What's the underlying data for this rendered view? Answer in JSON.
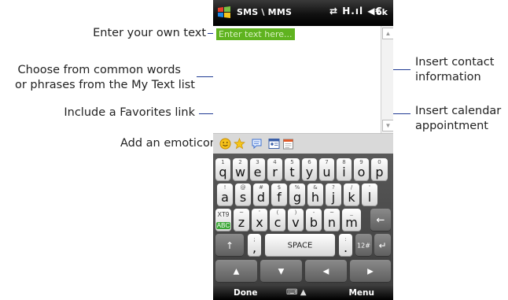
{
  "callouts": {
    "enter_text": "Enter your own text",
    "choose_words_line1": "Choose from common words",
    "choose_words_line2": "or phrases from the My Text list",
    "favorites_link": "Include a Favorites link",
    "emoticon": "Add an emoticon",
    "contact_line1": "Insert contact",
    "contact_line2": "information",
    "calendar_line1": "Insert calendar",
    "calendar_line2": "appointment"
  },
  "titlebar": {
    "title": "SMS \\ MMS",
    "status_icons": "⇄ H.ıl ◀€",
    "ok_label": "ok"
  },
  "message": {
    "placeholder": "Enter text here..."
  },
  "toolbar": {
    "icons": [
      "emoticon-icon",
      "favorites-star-icon",
      "my-text-icon",
      "contact-card-icon",
      "calendar-icon"
    ]
  },
  "keyboard": {
    "row1": [
      {
        "small": "1",
        "big": "q"
      },
      {
        "small": "2",
        "big": "w"
      },
      {
        "small": "3",
        "big": "e"
      },
      {
        "small": "4",
        "big": "r"
      },
      {
        "small": "5",
        "big": "t"
      },
      {
        "small": "6",
        "big": "y"
      },
      {
        "small": "7",
        "big": "u"
      },
      {
        "small": "8",
        "big": "i"
      },
      {
        "small": "9",
        "big": "o"
      },
      {
        "small": "0",
        "big": "p"
      }
    ],
    "row2": [
      {
        "small": "!",
        "big": "a"
      },
      {
        "small": "@",
        "big": "s"
      },
      {
        "small": "#",
        "big": "d"
      },
      {
        "small": "$",
        "big": "f"
      },
      {
        "small": "%",
        "big": "g"
      },
      {
        "small": "&",
        "big": "h"
      },
      {
        "small": "?",
        "big": "j"
      },
      {
        "small": "/",
        "big": "k"
      },
      {
        "small": "'",
        "big": "l"
      }
    ],
    "row3": [
      {
        "small": "~",
        "big": "z"
      },
      {
        "small": "'",
        "big": "x"
      },
      {
        "small": "(",
        "big": "c"
      },
      {
        "small": ")",
        "big": "v"
      },
      {
        "small": "-",
        "big": "b"
      },
      {
        "small": "~",
        "big": "n"
      },
      {
        "small": "_",
        "big": "m"
      }
    ],
    "xt9_top": "XT9",
    "xt9_bottom": "ABC",
    "backspace": "←",
    "shift": "↑",
    "comma_small": ";",
    "comma_big": ",",
    "space": "SPACE",
    "period_small": ":",
    "period_big": ".",
    "symbols": "12#",
    "enter": "↵",
    "arrow_up": "▲",
    "arrow_down": "▼",
    "arrow_left": "◀",
    "arrow_right": "▶"
  },
  "softbar": {
    "left": "Done",
    "right": "Menu",
    "keyboard_toggle": "⌨ ▲"
  },
  "colors": {
    "callout_line": "#1f3a93",
    "placeholder_bg": "#5fb31f",
    "xt9_green": "#3aa535"
  }
}
